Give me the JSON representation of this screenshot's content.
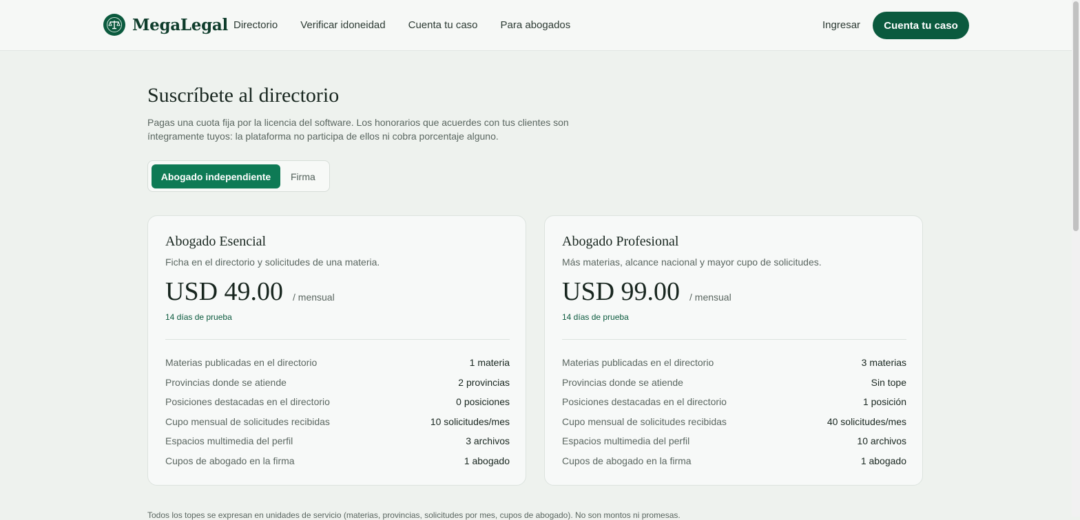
{
  "header": {
    "brand": "MegaLegal",
    "nav": [
      {
        "label": "Directorio"
      },
      {
        "label": "Verificar idoneidad"
      },
      {
        "label": "Cuenta tu caso"
      },
      {
        "label": "Para abogados"
      }
    ],
    "login_label": "Ingresar",
    "cta_label": "Cuenta tu caso"
  },
  "main": {
    "title": "Suscríbete al directorio",
    "lead": "Pagas una cuota fija por la licencia del software. Los honorarios que acuerdes con tus clientes son íntegramente tuyos: la plataforma no participa de ellos ni cobra porcentaje alguno.",
    "toggle": {
      "active": "Abogado independiente",
      "inactive": "Firma"
    },
    "plans": [
      {
        "name": "Abogado Esencial",
        "description": "Ficha en el directorio y solicitudes de una materia.",
        "price": "USD 49.00",
        "period": "/ mensual",
        "trial": "14 días de prueba",
        "features": [
          {
            "label": "Materias publicadas en el directorio",
            "value": "1 materia"
          },
          {
            "label": "Provincias donde se atiende",
            "value": "2 provincias"
          },
          {
            "label": "Posiciones destacadas en el directorio",
            "value": "0 posiciones"
          },
          {
            "label": "Cupo mensual de solicitudes recibidas",
            "value": "10 solicitudes/mes"
          },
          {
            "label": "Espacios multimedia del perfil",
            "value": "3 archivos"
          },
          {
            "label": "Cupos de abogado en la firma",
            "value": "1 abogado"
          }
        ]
      },
      {
        "name": "Abogado Profesional",
        "description": "Más materias, alcance nacional y mayor cupo de solicitudes.",
        "price": "USD 99.00",
        "period": "/ mensual",
        "trial": "14 días de prueba",
        "features": [
          {
            "label": "Materias publicadas en el directorio",
            "value": "3 materias"
          },
          {
            "label": "Provincias donde se atiende",
            "value": "Sin tope"
          },
          {
            "label": "Posiciones destacadas en el directorio",
            "value": "1 posición"
          },
          {
            "label": "Cupo mensual de solicitudes recibidas",
            "value": "40 solicitudes/mes"
          },
          {
            "label": "Espacios multimedia del perfil",
            "value": "10 archivos"
          },
          {
            "label": "Cupos de abogado en la firma",
            "value": "1 abogado"
          }
        ]
      }
    ],
    "footnote": "Todos los topes se expresan en unidades de servicio (materias, provincias, solicitudes por mes, cupos de abogado). No son montos ni promesas."
  },
  "colors": {
    "brand": "#0b5a3e",
    "accent": "#0e7a55",
    "background": "#eef2ee"
  },
  "icons": {
    "logo": "scales-of-justice-icon"
  }
}
